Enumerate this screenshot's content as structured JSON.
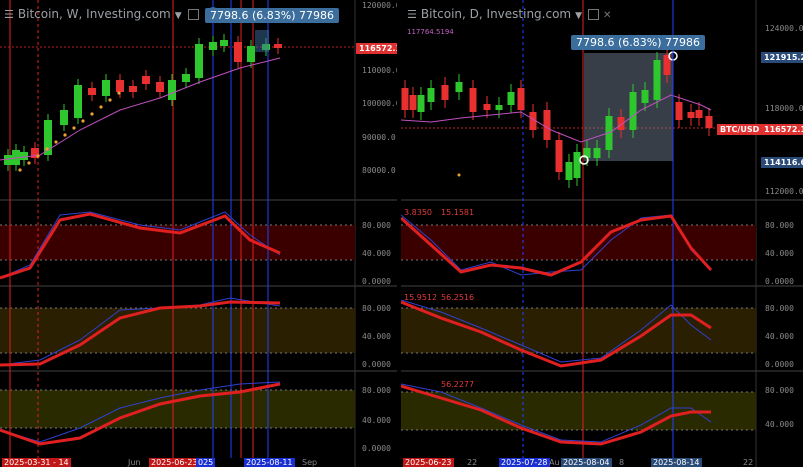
{
  "left_chart": {
    "title": "Bitcoin, W, Investing.com",
    "tooltip": "7798.6 (6.83%) 77986",
    "price_badge": "116572.1",
    "price_axis": [
      "120000.0",
      "110000.0",
      "100000.0",
      "90000.0",
      "80000.0"
    ],
    "osc1_axis": [
      "80.000",
      "40.000",
      "0.0000"
    ],
    "osc2_axis": [
      "80.000",
      "40.000",
      "0.0000"
    ],
    "osc3_axis": [
      "80.000",
      "40.000",
      "0.0000"
    ],
    "x_labels": [
      "2025-03-31 - 14",
      "Jun",
      "2025-06-23",
      "025",
      "2025-08-11",
      "Sep"
    ],
    "colors": {
      "up": "#2ec82e",
      "down": "#e83030",
      "ma": "#c050c0",
      "band": "#3a0000"
    }
  },
  "right_chart": {
    "title": "Bitcoin, D, Investing.com",
    "ma_value": "117764.5194",
    "tooltip": "7798.6 (6.83%) 77986",
    "price_axis": [
      "124000.0",
      "118000.0",
      "112000.0"
    ],
    "badges": {
      "high": "121915.2",
      "symbol": "BTC/USD",
      "current": "116572.1",
      "low": "114116.6"
    },
    "osc1_values": [
      "3.8350",
      "15.1581"
    ],
    "osc2_values": [
      "15.9512",
      "56.2516"
    ],
    "osc3_values": [
      "",
      "56.2277"
    ],
    "osc1_axis": [
      "80.000",
      "40.000",
      "0.0000"
    ],
    "osc2_axis": [
      "80.000",
      "40.000",
      "0.0000"
    ],
    "osc3_axis": [
      "80.000",
      "40.000"
    ],
    "x_labels": [
      "2025-06-23",
      "22",
      "2025-07-28",
      "Au",
      "2025-08-04",
      "8",
      "2025-08-14",
      "22"
    ]
  }
}
